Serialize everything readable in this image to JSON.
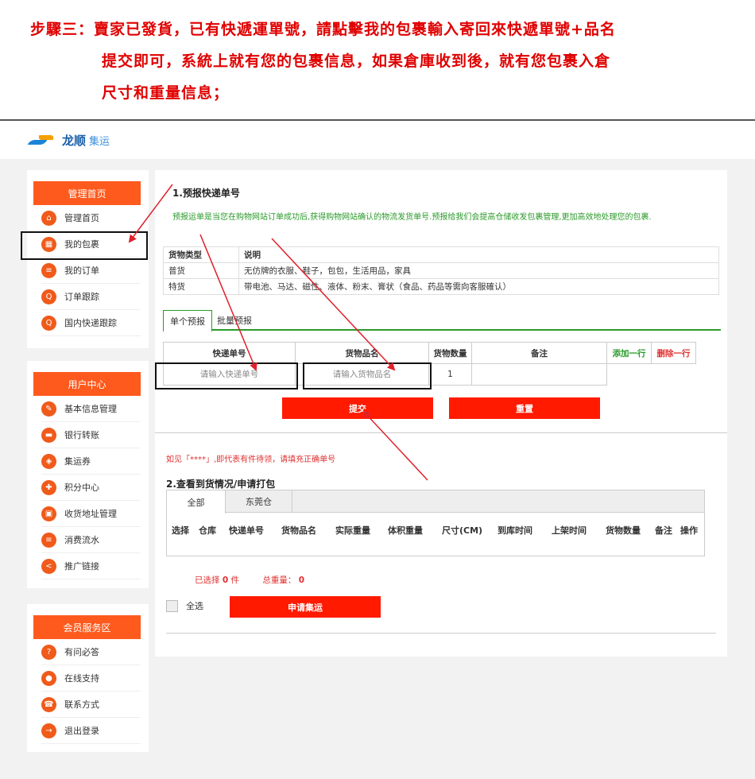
{
  "instruction": {
    "line1": "步驟三：賣家已發貨，已有快遞運單號，請點擊我的包裹輸入寄回來快遞單號+品名",
    "line2": "提交即可，系統上就有您的包裹信息，如果倉庫收到後，就有您包裹入倉",
    "line3": "尺寸和重量信息；"
  },
  "brand": {
    "name": "龙顺",
    "sub": "集运",
    "icon": "swoosh-logo"
  },
  "sidebar": {
    "groups": [
      {
        "title": "管理首页",
        "items": [
          {
            "label": "管理首页",
            "icon": "home-icon"
          },
          {
            "label": "我的包裹",
            "icon": "package-icon"
          },
          {
            "label": "我的订单",
            "icon": "list-icon"
          },
          {
            "label": "订单跟踪",
            "icon": "search-icon"
          },
          {
            "label": "国内快递跟踪",
            "icon": "search-icon"
          }
        ]
      },
      {
        "title": "用户中心",
        "items": [
          {
            "label": "基本信息管理",
            "icon": "edit-icon"
          },
          {
            "label": "银行转账",
            "icon": "card-icon"
          },
          {
            "label": "集运券",
            "icon": "ticket-icon"
          },
          {
            "label": "积分中心",
            "icon": "gift-icon"
          },
          {
            "label": "收货地址管理",
            "icon": "address-icon"
          },
          {
            "label": "消费流水",
            "icon": "list-icon"
          },
          {
            "label": "推广链接",
            "icon": "share-icon"
          }
        ]
      },
      {
        "title": "会员服务区",
        "items": [
          {
            "label": "有问必答",
            "icon": "question-icon"
          },
          {
            "label": "在线支持",
            "icon": "user-icon"
          },
          {
            "label": "联系方式",
            "icon": "phone-icon"
          },
          {
            "label": "退出登录",
            "icon": "logout-icon"
          }
        ]
      }
    ]
  },
  "preregister": {
    "title": "1.预报快递单号",
    "note": "预报运单是当您在购物网站订单成功后,获得购物网站确认的物流发货单号.预报给我们会提高仓储收发包裹管理,更加高效地处理您的包裹.",
    "type_table": {
      "headers": [
        "货物类型",
        "说明"
      ],
      "rows": [
        [
          "普货",
          "无仿牌的衣服、鞋子，包包，生活用品，家具"
        ],
        [
          "特货",
          "带电池、马达、磁性、液体、粉末、膏状（食品、药品等需向客服確认）"
        ]
      ]
    },
    "tabs": [
      "单个预报",
      "批量预报"
    ],
    "entry": {
      "headers": [
        "快递单号",
        "货物品名",
        "货物数量",
        "备注"
      ],
      "add_row": "添加一行",
      "delete_row": "删除一行",
      "tracking_placeholder": "请输入快递单号",
      "goods_placeholder": "请输入货物品名",
      "quantity": "1",
      "remark": ""
    },
    "submit": "提交",
    "reset": "重置",
    "warning": "如见「****」,即代表有件待领，请填充正确单号"
  },
  "arrival": {
    "title": "2.查看到货情况/申请打包",
    "tabs": [
      "全部",
      "东莞仓"
    ],
    "columns": [
      "选择",
      "仓库",
      "快递单号",
      "货物品名",
      "实际重量",
      "体积重量",
      "尺寸(CM)",
      "到库时间",
      "上架时间",
      "货物数量",
      "备注",
      "操作"
    ],
    "selected_label": "已选择",
    "selected_count": "0",
    "selected_unit": "件",
    "total_weight_label": "总重量：",
    "total_weight": "0",
    "select_all": "全选",
    "apply": "申请集运"
  },
  "colors": {
    "accent": "#ff5a1d",
    "button": "#ff1a00",
    "green": "#2a9a2a",
    "instruction": "#e00000",
    "arrow": "#e0202a"
  }
}
